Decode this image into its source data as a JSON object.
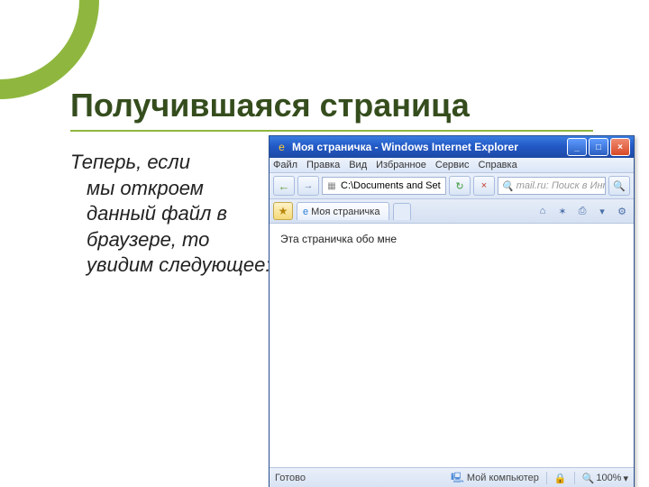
{
  "slide": {
    "title": "Получившаяся страница",
    "body_line1": "Теперь, если",
    "body_rest": "мы откроем данный файл в браузере, то  увидим следующее:"
  },
  "browser": {
    "window_title": "Моя страничка - Windows Internet Explorer",
    "menu": [
      "Файл",
      "Правка",
      "Вид",
      "Избранное",
      "Сервис",
      "Справка"
    ],
    "address": "C:\\Documents and Set",
    "search_placeholder": "mail.ru: Поиск в Интернете",
    "tab_title": "Моя страничка",
    "page_text": "Эта страничка обо мне",
    "status_ready": "Готово",
    "status_zone": "Мой компьютер",
    "zoom": "100%"
  }
}
